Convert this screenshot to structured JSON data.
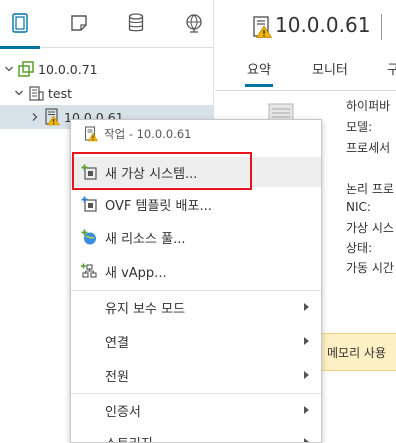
{
  "left_nav": {
    "tabs": [
      "hosts-and-clusters",
      "vms-and-templates",
      "storage",
      "networking"
    ],
    "active_tab": "hosts-and-clusters"
  },
  "tree": {
    "vcenter": "10.0.0.71",
    "datacenter": "test",
    "host": "10.0.0.61"
  },
  "header": {
    "title": "10.0.0.61"
  },
  "tabs": [
    "요약",
    "모니터",
    "구"
  ],
  "summary": {
    "labels": [
      "하이퍼바",
      "모델:",
      "프로세서",
      "논리 프로",
      "NIC:",
      "가상 시스",
      "상태:",
      "가동 시간"
    ]
  },
  "memory_banner": "메모리 사용",
  "context_menu": {
    "header": "작업 - 10.0.0.61",
    "items": [
      {
        "label": "새 가상 시스템...",
        "icon": "new-vm-icon"
      },
      {
        "label": "OVF 템플릿 배포...",
        "icon": "deploy-ovf-icon"
      },
      {
        "label": "새 리소스 풀...",
        "icon": "resource-pool-icon"
      },
      {
        "label": "새 vApp...",
        "icon": "vapp-icon"
      }
    ],
    "submenus": [
      "유지 보수 모드",
      "연결",
      "전원",
      "인증서",
      "스토리지"
    ]
  },
  "colors": {
    "accent": "#0072a3",
    "selection": "#d8e3e9",
    "highlight_box": "#e8141c",
    "warning": "#f0b400"
  }
}
